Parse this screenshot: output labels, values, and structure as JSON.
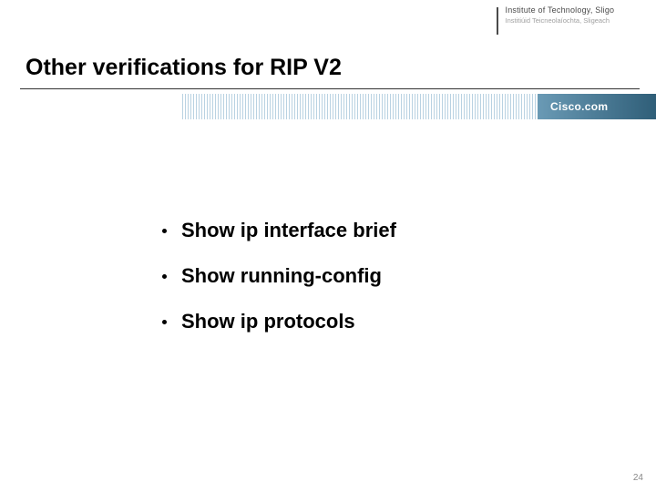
{
  "header": {
    "institute_line1": "Institute of Technology, Sligo",
    "institute_line2": "Institiúid Teicneolaíochta, Sligeach"
  },
  "title": "Other verifications for RIP V2",
  "brand": {
    "label": "Cisco.com"
  },
  "bullets": [
    "Show ip interface brief",
    "Show running-config",
    "Show ip protocols"
  ],
  "page_number": "24"
}
